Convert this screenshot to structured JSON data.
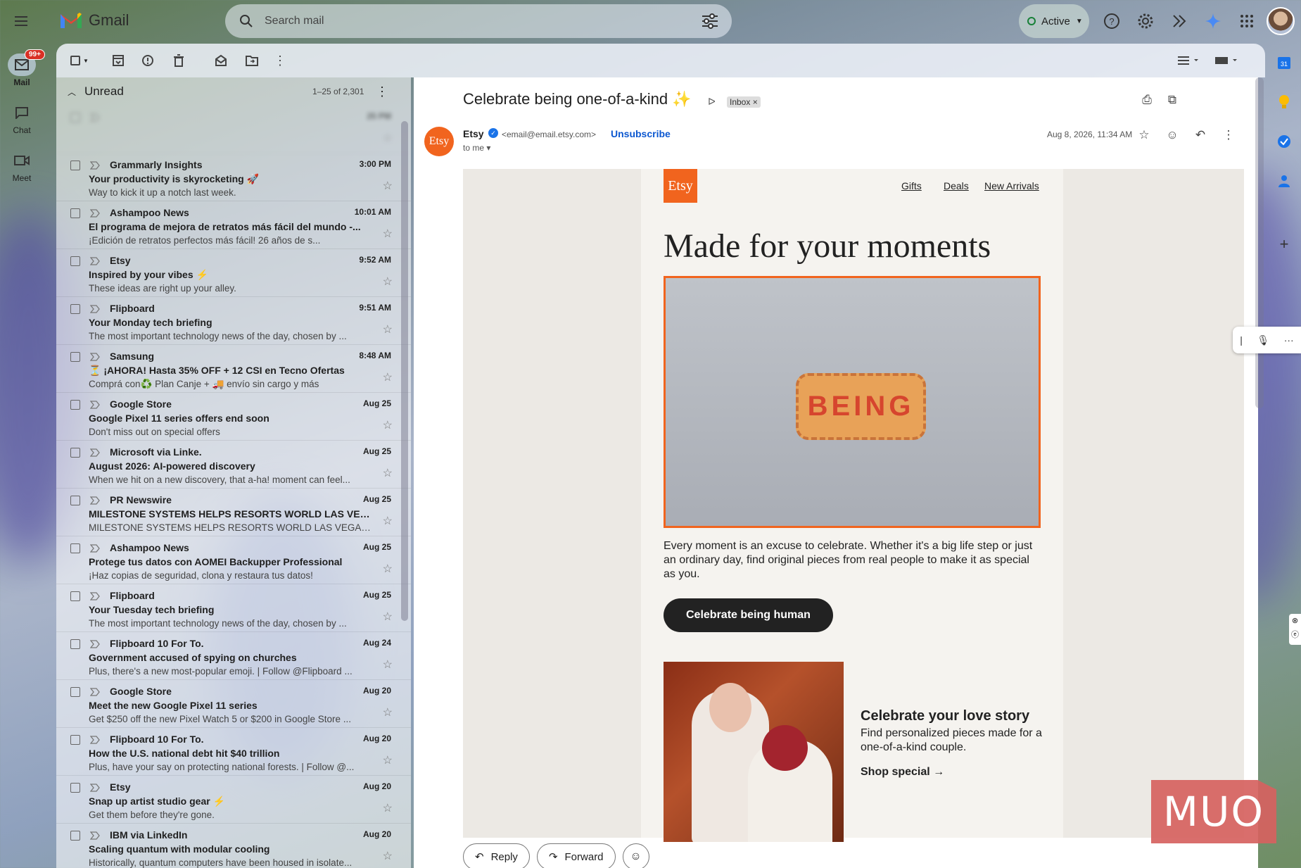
{
  "app": {
    "name": "Gmail"
  },
  "search": {
    "placeholder": "Search mail"
  },
  "status": {
    "label": "Active"
  },
  "rail": [
    {
      "label": "Mail",
      "badge": "99+"
    },
    {
      "label": "Chat"
    },
    {
      "label": "Meet"
    }
  ],
  "list": {
    "section": "Unread",
    "count": "1–25 of 2,301",
    "rows": [
      {
        "sender": "",
        "time": "25 PM",
        "subject": "",
        "snippet": ""
      },
      {
        "sender": "Grammarly Insights",
        "time": "3:00 PM",
        "subject": "Your productivity is skyrocketing 🚀",
        "snippet": "Way to kick it up a notch last week."
      },
      {
        "sender": "Ashampoo News",
        "time": "10:01 AM",
        "subject": "El programa de mejora de retratos más fácil del mundo -...",
        "snippet": "¡Edición de retratos perfectos más fácil!           26 años de s..."
      },
      {
        "sender": "Etsy",
        "time": "9:52 AM",
        "subject": "Inspired by your vibes ⚡",
        "snippet": "These ideas are right up your alley."
      },
      {
        "sender": "Flipboard",
        "time": "9:51 AM",
        "subject": "Your Monday tech briefing",
        "snippet": "The most important technology news of the day, chosen by ..."
      },
      {
        "sender": "Samsung",
        "time": "8:48 AM",
        "subject": "⏳ ¡AHORA! Hasta 35% OFF + 12 CSI en Tecno Ofertas",
        "snippet": "Comprá con♻️ Plan Canje + 🚚 envío sin cargo y más"
      },
      {
        "sender": "Google Store",
        "time": "Aug 25",
        "subject": "Google Pixel 11 series offers end soon",
        "snippet": "Don't miss out on special offers"
      },
      {
        "sender": "Microsoft via Linke.",
        "time": "Aug 25",
        "subject": "August 2026: AI-powered discovery",
        "snippet": "When we hit on a new discovery, that a-ha! moment can feel..."
      },
      {
        "sender": "PR Newswire",
        "time": "Aug 25",
        "subject": "MILESTONE SYSTEMS HELPS RESORTS WORLD LAS VEG...",
        "snippet": "MILESTONE SYSTEMS HELPS RESORTS WORLD LAS VEGAS ..."
      },
      {
        "sender": "Ashampoo News",
        "time": "Aug 25",
        "subject": "Protege tus datos con AOMEI Backupper Professional",
        "snippet": "¡Haz copias de seguridad, clona y restaura tus datos!"
      },
      {
        "sender": "Flipboard",
        "time": "Aug 25",
        "subject": "Your Tuesday tech briefing",
        "snippet": "The most important technology news of the day, chosen by ..."
      },
      {
        "sender": "Flipboard 10 For To.",
        "time": "Aug 24",
        "subject": "Government accused of spying on churches",
        "snippet": "Plus, there's a new most-popular emoji. | Follow @Flipboard ..."
      },
      {
        "sender": "Google Store",
        "time": "Aug 20",
        "subject": "Meet the new Google Pixel 11 series",
        "snippet": "Get $250 off the new Pixel Watch 5 or $200 in Google Store ..."
      },
      {
        "sender": "Flipboard 10 For To.",
        "time": "Aug 20",
        "subject": "How the U.S. national debt hit $40 trillion",
        "snippet": "Plus, have your say on protecting national forests. | Follow @..."
      },
      {
        "sender": "Etsy",
        "time": "Aug 20",
        "subject": "Snap up artist studio gear ⚡",
        "snippet": "Get them before they're gone."
      },
      {
        "sender": "IBM via LinkedIn",
        "time": "Aug 20",
        "subject": "Scaling quantum with modular cooling",
        "snippet": "Historically, quantum computers have been housed in isolate..."
      }
    ]
  },
  "email": {
    "subject": "Celebrate being one-of-a-kind ✨",
    "label": "Inbox ×",
    "avatar_text": "Etsy",
    "from_name": "Etsy",
    "from_email": "<email@email.etsy.com>",
    "unsubscribe": "Unsubscribe",
    "to": "to me ▾",
    "date": "Aug 8, 2026, 11:34 AM",
    "body": {
      "logo": "Etsy",
      "nav": [
        "Gifts",
        "Deals",
        "New Arrivals"
      ],
      "headline": "Made for your moments",
      "patch_text": "BEING",
      "paragraph": "Every moment is an excuse to celebrate. Whether it's a big life step or just an ordinary day, find original pieces from real people to make it as special as you.",
      "cta": "Celebrate being human",
      "love_title": "Celebrate your love story",
      "love_text": "Find personalized pieces made for a one-of-a-kind couple.",
      "shop_link": "Shop special →"
    },
    "actions": {
      "reply": "Reply",
      "forward": "Forward"
    }
  },
  "watermark": "MUO",
  "colors": {
    "accent": "#f1641e",
    "link": "#0b57d0",
    "badge": "#d93025"
  }
}
